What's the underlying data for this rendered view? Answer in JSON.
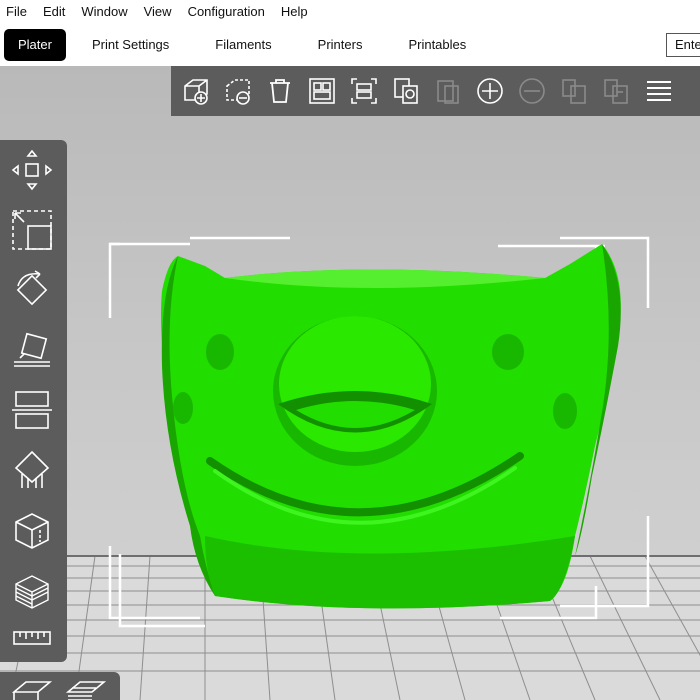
{
  "menu": {
    "items": [
      "File",
      "Edit",
      "Window",
      "View",
      "Configuration",
      "Help"
    ]
  },
  "tabs": {
    "plater": "Plater",
    "print_settings": "Print Settings",
    "filaments": "Filaments",
    "printers": "Printers",
    "printables": "Printables"
  },
  "search": {
    "value": "Ente"
  },
  "colors": {
    "model": "#22dd00",
    "toolbar": "#5c5c5c",
    "active_tab": "#000000",
    "bed": "#d9d9d9"
  },
  "top_toolbar": {
    "buttons": [
      "add-icon",
      "delete-icon",
      "delete-all-icon",
      "arrange-icon",
      "arrange-selection-icon",
      "copy-icon",
      "paste-icon",
      "add-instance-icon",
      "remove-instance-icon",
      "split-objects-icon",
      "split-parts-icon",
      "layers-editing-icon"
    ]
  },
  "left_toolbar": {
    "buttons": [
      "move-icon",
      "scale-icon",
      "rotate-icon",
      "place-on-face-icon",
      "cut-icon",
      "support-paint-icon",
      "seam-paint-icon",
      "measure-cube-icon",
      "ruler-icon"
    ]
  }
}
